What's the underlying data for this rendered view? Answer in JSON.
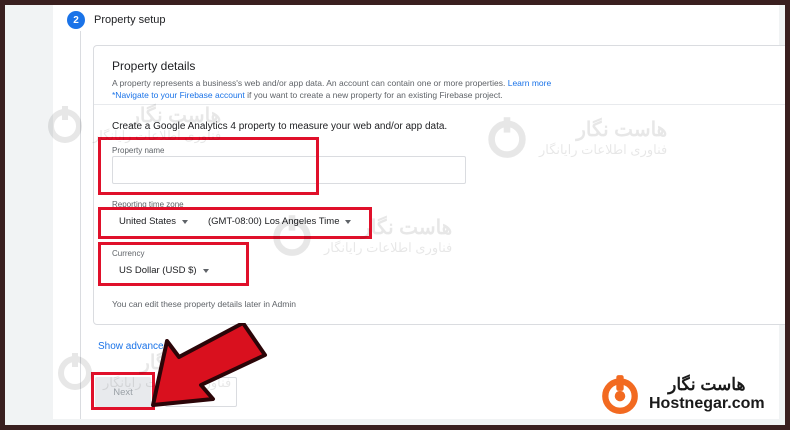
{
  "step": {
    "number": "2",
    "title": "Property setup"
  },
  "card": {
    "title": "Property details",
    "desc_line1": "A property represents a business's web and/or app data. An account can contain one or more properties.",
    "learn_more": "Learn more",
    "desc_link2": "*Navigate to your Firebase account",
    "desc_line2_rest": "if you want to create a new property for an existing Firebase project.",
    "intro": "Create a Google Analytics 4 property to measure your web and/or app data.",
    "property_name_label": "Property name",
    "property_name_value": "",
    "timezone_label": "Reporting time zone",
    "timezone_country": "United States",
    "timezone_zone": "(GMT-08:00) Los Angeles Time",
    "currency_label": "Currency",
    "currency_value": "US Dollar (USD $)",
    "note": "You can edit these property details later in Admin"
  },
  "show_advanced": "Show advanced",
  "next_label": "Next",
  "watermark": {
    "fa": "هاست نگار",
    "sub": "فناوری اطلاعات رایانگار"
  },
  "logo": {
    "fa": "هاست نگار",
    "en": "Hostnegar.com"
  },
  "colors": {
    "accent": "#1a73e8",
    "highlight": "#e0102a",
    "arrow": "#d9101e",
    "logo_orange": "#f26a21"
  }
}
